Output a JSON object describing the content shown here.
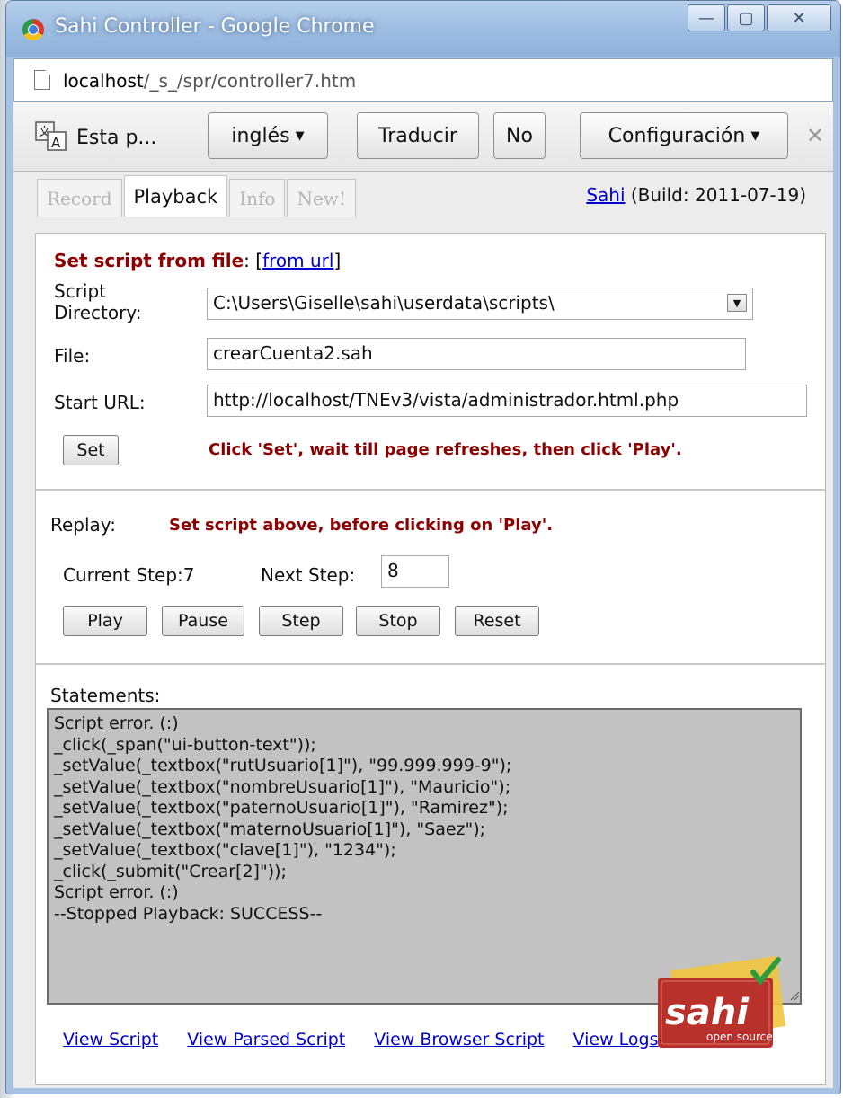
{
  "window": {
    "title": "Sahi Controller - Google Chrome",
    "controls": {
      "minimize": "—",
      "maximize": "▢",
      "close": "✕"
    }
  },
  "address_bar": {
    "host": "localhost",
    "path": "/_s_/spr/controller7.htm"
  },
  "translate_bar": {
    "message": "Esta p...",
    "language": "inglés",
    "translate_label": "Traducir",
    "no_label": "No",
    "settings_label": "Configuración",
    "close_glyph": "✕"
  },
  "tabs": [
    {
      "label": "Record",
      "active": false
    },
    {
      "label": "Playback",
      "active": true
    },
    {
      "label": "Info",
      "active": false
    },
    {
      "label": "New!",
      "active": false
    }
  ],
  "build": {
    "link": "Sahi",
    "text": "(Build: 2011-07-19)"
  },
  "set_script": {
    "title": "Set script from file",
    "colon": ":",
    "from_url_open": "[",
    "from_url": "from url",
    "from_url_close": "]",
    "script_dir_label_1": "Script",
    "script_dir_label_2": "Directory:",
    "script_dir_value": "C:\\Users\\Giselle\\sahi\\userdata\\scripts\\",
    "file_label": "File:",
    "file_value": "crearCuenta2.sah",
    "start_url_label": "Start URL:",
    "start_url_value": "http://localhost/TNEv3/vista/administrador.html.php",
    "set_button": "Set",
    "hint": "Click 'Set', wait till page refreshes, then click 'Play'."
  },
  "replay": {
    "label": "Replay:",
    "hint": "Set script above, before clicking on 'Play'.",
    "current_step_label": "Current Step:",
    "current_step": "7",
    "next_step_label": "Next Step:",
    "next_step": "8",
    "buttons": {
      "play": "Play",
      "pause": "Pause",
      "step": "Step",
      "stop": "Stop",
      "reset": "Reset"
    }
  },
  "statements": {
    "label": "Statements:",
    "lines": [
      "Script error. (:)",
      "_click(_span(\"ui-button-text\"));",
      "_setValue(_textbox(\"rutUsuario[1]\"), \"99.999.999-9\");",
      "_setValue(_textbox(\"nombreUsuario[1]\"), \"Mauricio\");",
      "_setValue(_textbox(\"paternoUsuario[1]\"), \"Ramirez\");",
      "_setValue(_textbox(\"maternoUsuario[1]\"), \"Saez\");",
      "_setValue(_textbox(\"clave[1]\"), \"1234\");",
      "_click(_submit(\"Crear[2]\"));",
      "Script error. (:)",
      "--Stopped Playback: SUCCESS--"
    ],
    "logo_text": "sahi",
    "logo_subtext": "open source"
  },
  "links": {
    "view_script": "View Script",
    "view_parsed_script": "View Parsed Script",
    "view_browser_script": "View Browser Script",
    "view_logs": "View Logs"
  },
  "colors": {
    "titlebar": "#9dbde2",
    "accent_dark_red": "#8b0000",
    "link_blue": "#0000cc",
    "statements_bg": "#c2c2c2"
  }
}
